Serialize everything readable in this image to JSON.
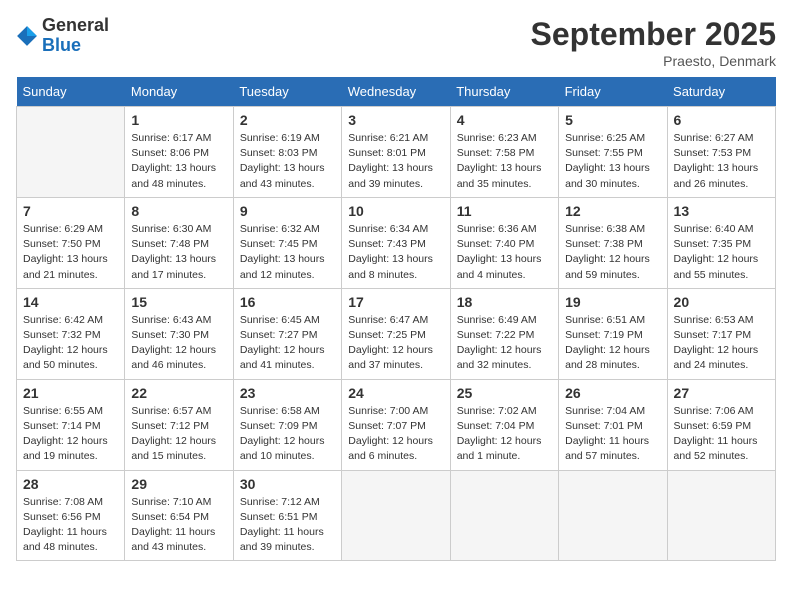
{
  "logo": {
    "text_general": "General",
    "text_blue": "Blue"
  },
  "title": "September 2025",
  "location": "Praesto, Denmark",
  "days_of_week": [
    "Sunday",
    "Monday",
    "Tuesday",
    "Wednesday",
    "Thursday",
    "Friday",
    "Saturday"
  ],
  "weeks": [
    [
      {
        "day": "",
        "info": ""
      },
      {
        "day": "1",
        "info": "Sunrise: 6:17 AM\nSunset: 8:06 PM\nDaylight: 13 hours and 48 minutes."
      },
      {
        "day": "2",
        "info": "Sunrise: 6:19 AM\nSunset: 8:03 PM\nDaylight: 13 hours and 43 minutes."
      },
      {
        "day": "3",
        "info": "Sunrise: 6:21 AM\nSunset: 8:01 PM\nDaylight: 13 hours and 39 minutes."
      },
      {
        "day": "4",
        "info": "Sunrise: 6:23 AM\nSunset: 7:58 PM\nDaylight: 13 hours and 35 minutes."
      },
      {
        "day": "5",
        "info": "Sunrise: 6:25 AM\nSunset: 7:55 PM\nDaylight: 13 hours and 30 minutes."
      },
      {
        "day": "6",
        "info": "Sunrise: 6:27 AM\nSunset: 7:53 PM\nDaylight: 13 hours and 26 minutes."
      }
    ],
    [
      {
        "day": "7",
        "info": "Sunrise: 6:29 AM\nSunset: 7:50 PM\nDaylight: 13 hours and 21 minutes."
      },
      {
        "day": "8",
        "info": "Sunrise: 6:30 AM\nSunset: 7:48 PM\nDaylight: 13 hours and 17 minutes."
      },
      {
        "day": "9",
        "info": "Sunrise: 6:32 AM\nSunset: 7:45 PM\nDaylight: 13 hours and 12 minutes."
      },
      {
        "day": "10",
        "info": "Sunrise: 6:34 AM\nSunset: 7:43 PM\nDaylight: 13 hours and 8 minutes."
      },
      {
        "day": "11",
        "info": "Sunrise: 6:36 AM\nSunset: 7:40 PM\nDaylight: 13 hours and 4 minutes."
      },
      {
        "day": "12",
        "info": "Sunrise: 6:38 AM\nSunset: 7:38 PM\nDaylight: 12 hours and 59 minutes."
      },
      {
        "day": "13",
        "info": "Sunrise: 6:40 AM\nSunset: 7:35 PM\nDaylight: 12 hours and 55 minutes."
      }
    ],
    [
      {
        "day": "14",
        "info": "Sunrise: 6:42 AM\nSunset: 7:32 PM\nDaylight: 12 hours and 50 minutes."
      },
      {
        "day": "15",
        "info": "Sunrise: 6:43 AM\nSunset: 7:30 PM\nDaylight: 12 hours and 46 minutes."
      },
      {
        "day": "16",
        "info": "Sunrise: 6:45 AM\nSunset: 7:27 PM\nDaylight: 12 hours and 41 minutes."
      },
      {
        "day": "17",
        "info": "Sunrise: 6:47 AM\nSunset: 7:25 PM\nDaylight: 12 hours and 37 minutes."
      },
      {
        "day": "18",
        "info": "Sunrise: 6:49 AM\nSunset: 7:22 PM\nDaylight: 12 hours and 32 minutes."
      },
      {
        "day": "19",
        "info": "Sunrise: 6:51 AM\nSunset: 7:19 PM\nDaylight: 12 hours and 28 minutes."
      },
      {
        "day": "20",
        "info": "Sunrise: 6:53 AM\nSunset: 7:17 PM\nDaylight: 12 hours and 24 minutes."
      }
    ],
    [
      {
        "day": "21",
        "info": "Sunrise: 6:55 AM\nSunset: 7:14 PM\nDaylight: 12 hours and 19 minutes."
      },
      {
        "day": "22",
        "info": "Sunrise: 6:57 AM\nSunset: 7:12 PM\nDaylight: 12 hours and 15 minutes."
      },
      {
        "day": "23",
        "info": "Sunrise: 6:58 AM\nSunset: 7:09 PM\nDaylight: 12 hours and 10 minutes."
      },
      {
        "day": "24",
        "info": "Sunrise: 7:00 AM\nSunset: 7:07 PM\nDaylight: 12 hours and 6 minutes."
      },
      {
        "day": "25",
        "info": "Sunrise: 7:02 AM\nSunset: 7:04 PM\nDaylight: 12 hours and 1 minute."
      },
      {
        "day": "26",
        "info": "Sunrise: 7:04 AM\nSunset: 7:01 PM\nDaylight: 11 hours and 57 minutes."
      },
      {
        "day": "27",
        "info": "Sunrise: 7:06 AM\nSunset: 6:59 PM\nDaylight: 11 hours and 52 minutes."
      }
    ],
    [
      {
        "day": "28",
        "info": "Sunrise: 7:08 AM\nSunset: 6:56 PM\nDaylight: 11 hours and 48 minutes."
      },
      {
        "day": "29",
        "info": "Sunrise: 7:10 AM\nSunset: 6:54 PM\nDaylight: 11 hours and 43 minutes."
      },
      {
        "day": "30",
        "info": "Sunrise: 7:12 AM\nSunset: 6:51 PM\nDaylight: 11 hours and 39 minutes."
      },
      {
        "day": "",
        "info": ""
      },
      {
        "day": "",
        "info": ""
      },
      {
        "day": "",
        "info": ""
      },
      {
        "day": "",
        "info": ""
      }
    ]
  ]
}
